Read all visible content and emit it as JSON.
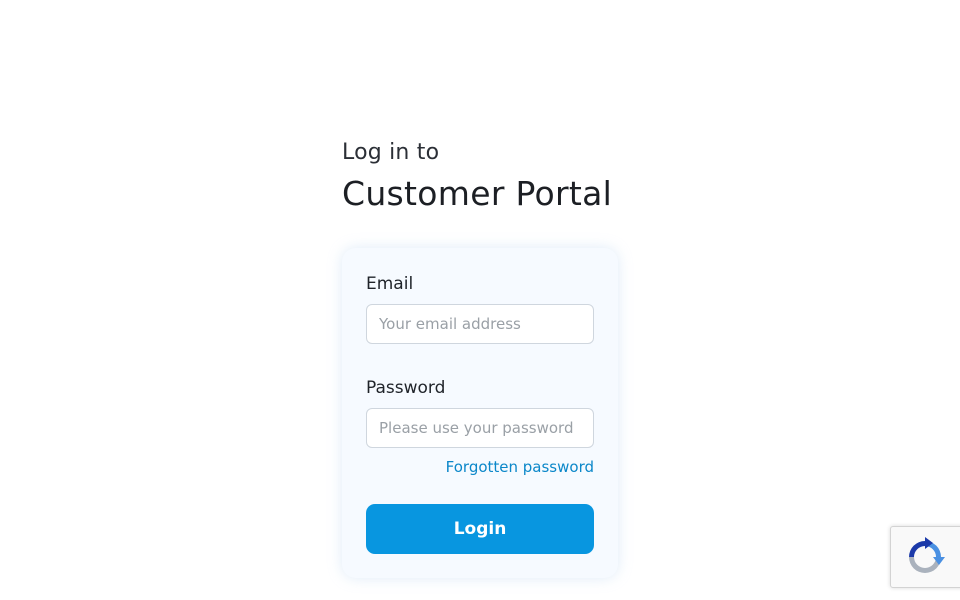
{
  "heading": {
    "subtitle": "Log in to",
    "title": "Customer Portal"
  },
  "form": {
    "email_label": "Email",
    "email_placeholder": "Your email address",
    "email_value": "",
    "password_label": "Password",
    "password_placeholder": "Please use your password",
    "password_value": "",
    "forgot_link": "Forgotten password",
    "login_label": "Login"
  },
  "colors": {
    "accent": "#0896e0",
    "link": "#0b87c9",
    "card_background": "#f6faff"
  },
  "icons": {
    "recaptcha": "recaptcha-icon"
  }
}
